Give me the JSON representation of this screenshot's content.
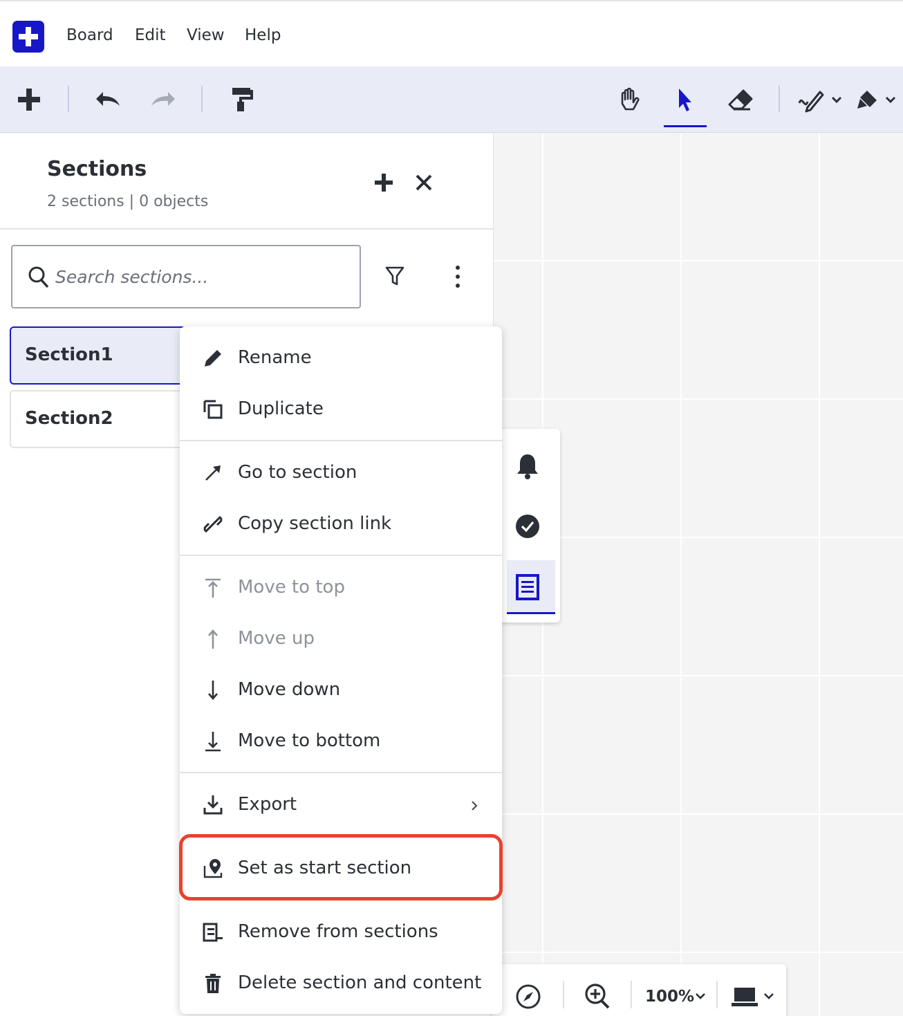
{
  "menubar": {
    "items": [
      "Board",
      "Edit",
      "View",
      "Help"
    ]
  },
  "toolbar": {
    "tools": [
      "add-icon",
      "undo-icon",
      "redo-icon",
      "format-painter-icon",
      "hand-icon",
      "select-pointer-icon",
      "eraser-icon",
      "pen-icon",
      "highlighter-icon"
    ],
    "active_tool": "select-pointer-icon"
  },
  "panel": {
    "title": "Sections",
    "subtitle": "2 sections | 0 objects",
    "search_placeholder": "Search sections...",
    "sections": [
      {
        "label": "Section1",
        "selected": true
      },
      {
        "label": "Section2",
        "selected": false
      }
    ]
  },
  "context_menu": {
    "rename": "Rename",
    "duplicate": "Duplicate",
    "go_to": "Go to section",
    "copy_link": "Copy section link",
    "move_top": "Move to top",
    "move_up": "Move up",
    "move_down": "Move down",
    "move_bottom": "Move to bottom",
    "export": "Export",
    "set_start": "Set as start section",
    "remove": "Remove from sections",
    "delete": "Delete section and content",
    "disabled_items": [
      "Move to top",
      "Move up"
    ]
  },
  "bottom_toolbar": {
    "zoom": "100%"
  },
  "colors": {
    "brand": "#1717c8",
    "toolbar_bg": "#e9ecf7",
    "highlight": "#e8422d"
  }
}
